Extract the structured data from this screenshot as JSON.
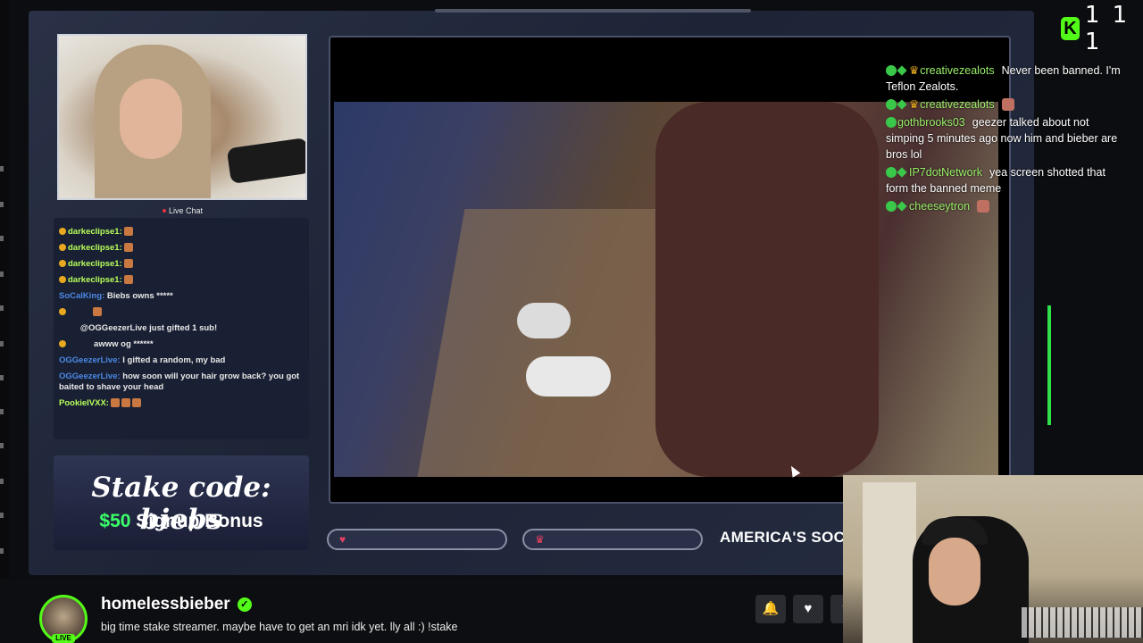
{
  "viewer_count": "1 1 1",
  "brand_logo_letter": "K",
  "overlay": {
    "live_chat_label": "Live Chat",
    "chat": [
      {
        "user": "darkeclipse1:",
        "text": ""
      },
      {
        "user": "darkeclipse1:",
        "text": ""
      },
      {
        "user": "darkeclipse1:",
        "text": ""
      },
      {
        "user": "darkeclipse1:",
        "text": ""
      },
      {
        "user": "SoCalKing:",
        "text": "Biebs owns *****"
      },
      {
        "user": "",
        "text": ""
      },
      {
        "user": "",
        "text": "@OGGeezerLive just gifted 1 sub!"
      },
      {
        "user": "",
        "text": "awww og ******"
      },
      {
        "user": "OGGeezerLive:",
        "text": "I gifted a random, my bad"
      },
      {
        "user": "OGGeezerLive:",
        "text": "how soon will your hair grow back? you got baited to shave your head"
      },
      {
        "user": "PookieIVXX:",
        "text": ""
      }
    ],
    "ad": {
      "line1": "Stake code: biebs",
      "line2_amount": "$50",
      "line2_rest": " Signup Bonus"
    },
    "ticker": "AMERICA'S SOC"
  },
  "right_chat": [
    {
      "user": "creativezealots",
      "text": "Never been banned. I'm Teflon Zealots.",
      "crown": true
    },
    {
      "user": "creativezealots",
      "text": "",
      "crown": true
    },
    {
      "user": "gothbrooks03",
      "text": "geezer talked about not simping 5 minutes ago now him and bieber are bros lol",
      "crown": false
    },
    {
      "user": "IP7dotNetwork",
      "text": "yea screen shotted that form the banned meme",
      "crown": false
    },
    {
      "user": "cheeseytron",
      "text": "",
      "crown": false
    }
  ],
  "channel": {
    "name": "homelessbieber",
    "description": "big time stake streamer. maybe have to get an mri idk yet. lly all :) !stake",
    "live_label": "LIVE"
  },
  "icons": {
    "heart": "♥",
    "crown": "♛",
    "bell": "🔔",
    "verified": "✓",
    "share": "⇪"
  }
}
